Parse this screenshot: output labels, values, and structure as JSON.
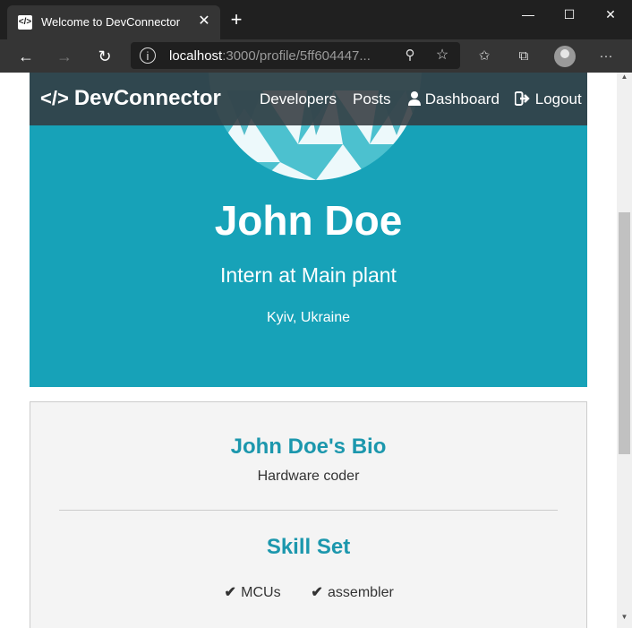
{
  "browser": {
    "tab_title": "Welcome to DevConnector",
    "url_host": "localhost",
    "url_rest": ":3000/profile/5ff604447..."
  },
  "site": {
    "brand": "DevConnector",
    "nav": {
      "developers": "Developers",
      "posts": "Posts",
      "dashboard": "Dashboard",
      "logout": "Logout"
    }
  },
  "profile": {
    "name": "John Doe",
    "status": "Intern at Main plant",
    "location": "Kyiv, Ukraine"
  },
  "bio": {
    "heading": "John Doe's Bio",
    "text": "Hardware coder",
    "skills_heading": "Skill Set",
    "skills": [
      "MCUs",
      "assembler"
    ]
  },
  "colors": {
    "primary": "#17a2b8",
    "dark": "#343a40",
    "light": "#f4f4f4"
  }
}
